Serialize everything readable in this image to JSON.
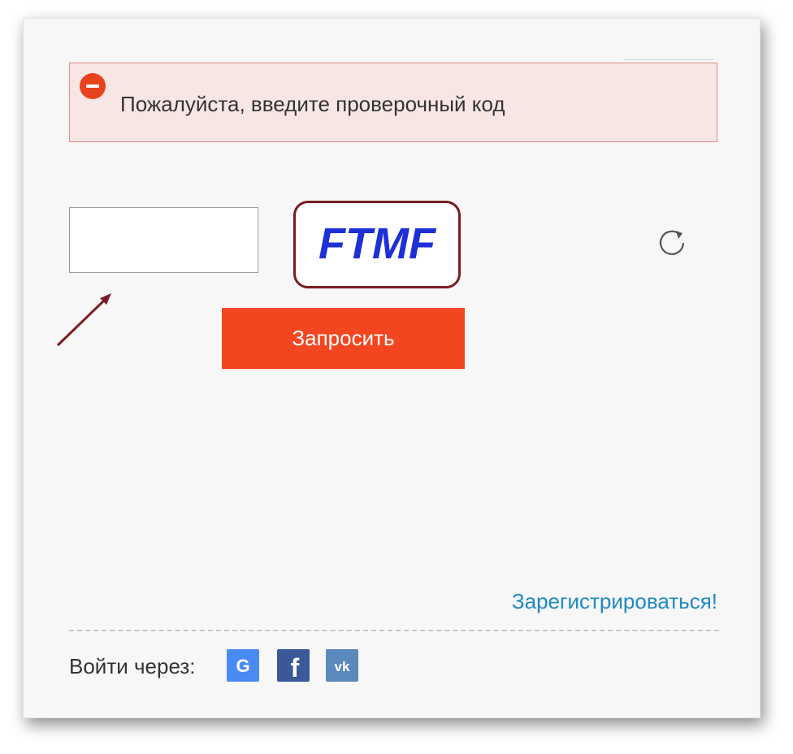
{
  "error": {
    "message": "Пожалуйста, введите проверочный код"
  },
  "captcha": {
    "input_value": "",
    "image_text": "FTMF"
  },
  "buttons": {
    "submit_label": "Запросить"
  },
  "links": {
    "register_label": "Зарегистрироваться!"
  },
  "social": {
    "label": "Войти через:",
    "providers": [
      {
        "name": "Google",
        "icon": "google-icon",
        "color": "#4a8af4"
      },
      {
        "name": "Facebook",
        "icon": "facebook-icon",
        "color": "#3b5998"
      },
      {
        "name": "VK",
        "icon": "vk-icon",
        "color": "#5b88bd"
      }
    ]
  },
  "colors": {
    "accent": "#f3451f",
    "error_bg": "#f8e6e5",
    "error_border": "#e08a86",
    "link": "#1f89c3",
    "annotation": "#7a1c24"
  }
}
